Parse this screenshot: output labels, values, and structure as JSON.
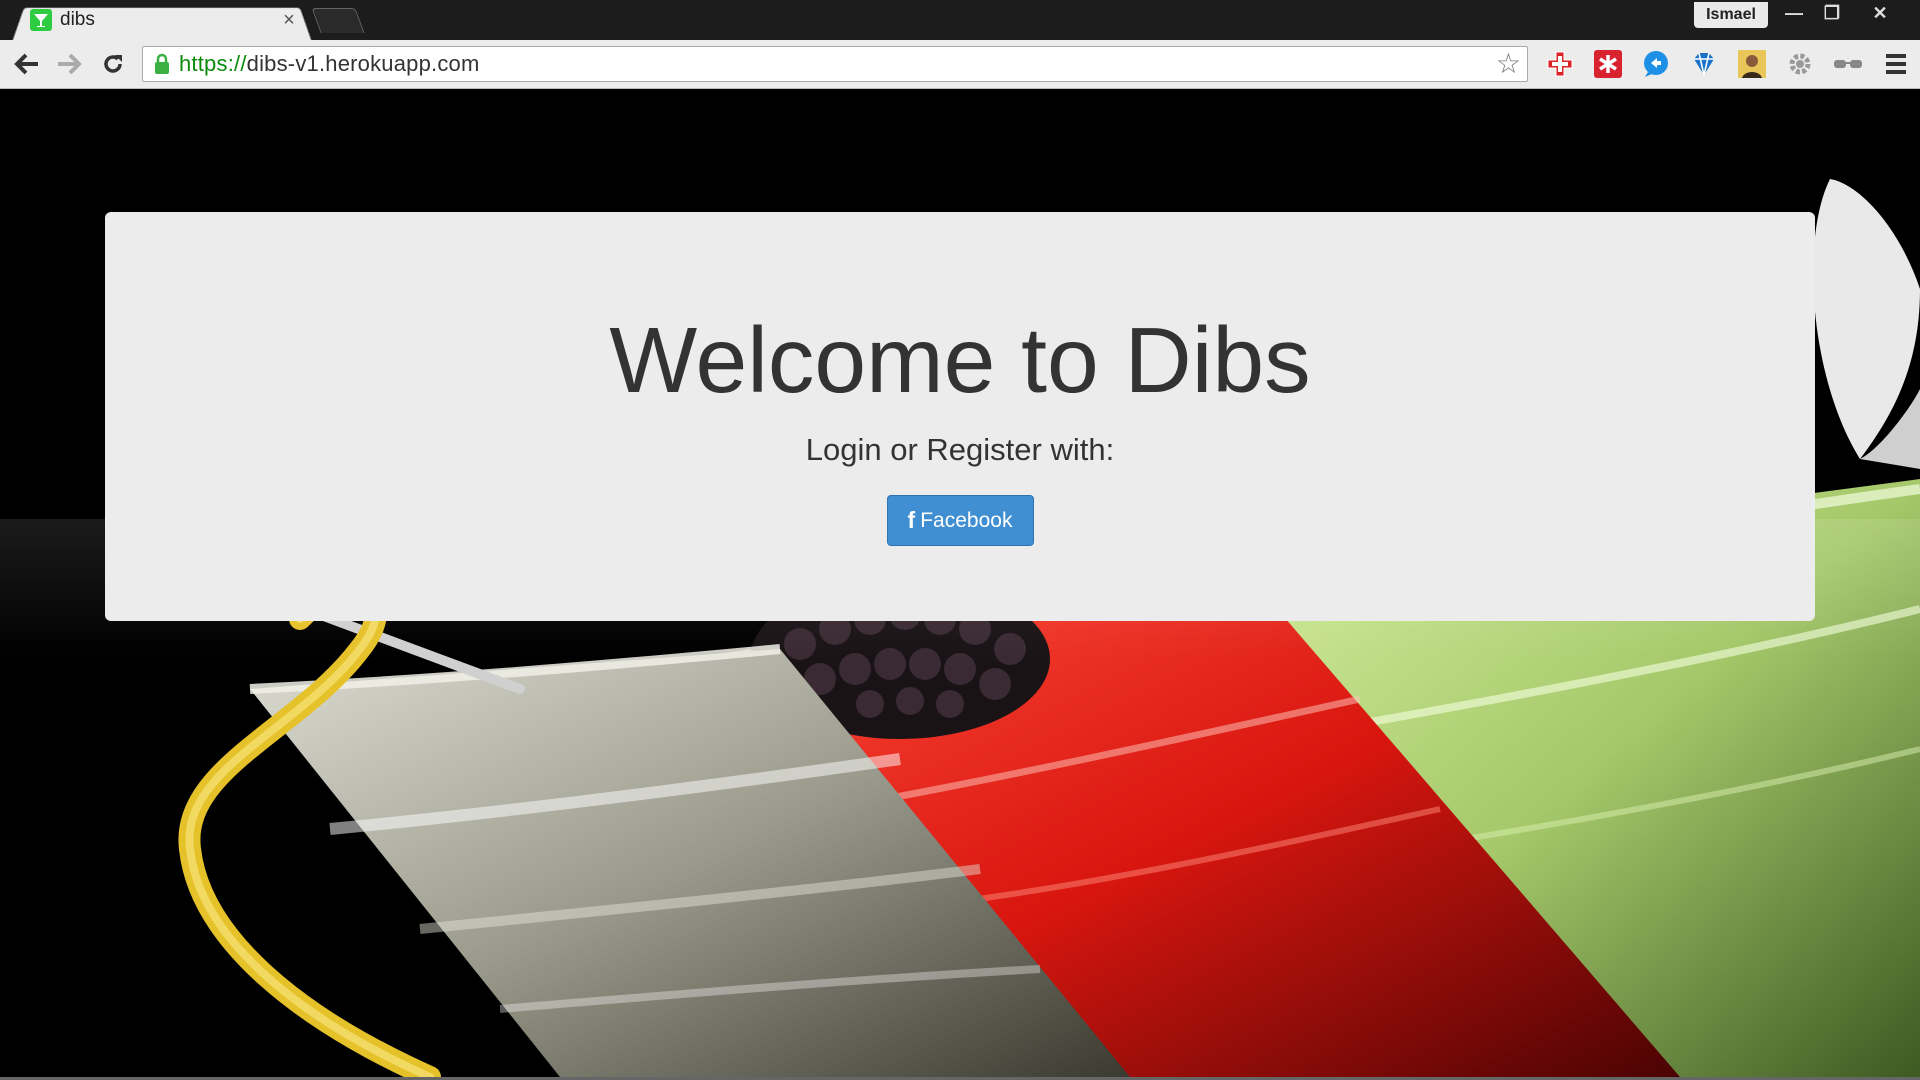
{
  "browser": {
    "tab": {
      "title": "dibs",
      "close_glyph": "×"
    },
    "profile_name": "Ismael",
    "window_controls": {
      "minimize": "—",
      "restore": "❐",
      "close": "✕"
    },
    "address": {
      "scheme": "https://",
      "host": "dibs-v1.herokuapp.com"
    },
    "extensions": [
      "plus-cross-icon",
      "red-asterisk-icon",
      "blue-chat-icon",
      "diamond-icon",
      "profile-photo-icon",
      "gear-icon",
      "glasses-icon"
    ],
    "menu_icon": "hamburger-menu-icon"
  },
  "page": {
    "heading": "Welcome to Dibs",
    "subtitle": "Login or Register with:",
    "facebook_button": {
      "icon_glyph": "f",
      "label": "Facebook"
    }
  },
  "colors": {
    "jumbotron_bg": "#ececec",
    "facebook_blue": "#3f8fd2",
    "page_bg": "#000000"
  }
}
